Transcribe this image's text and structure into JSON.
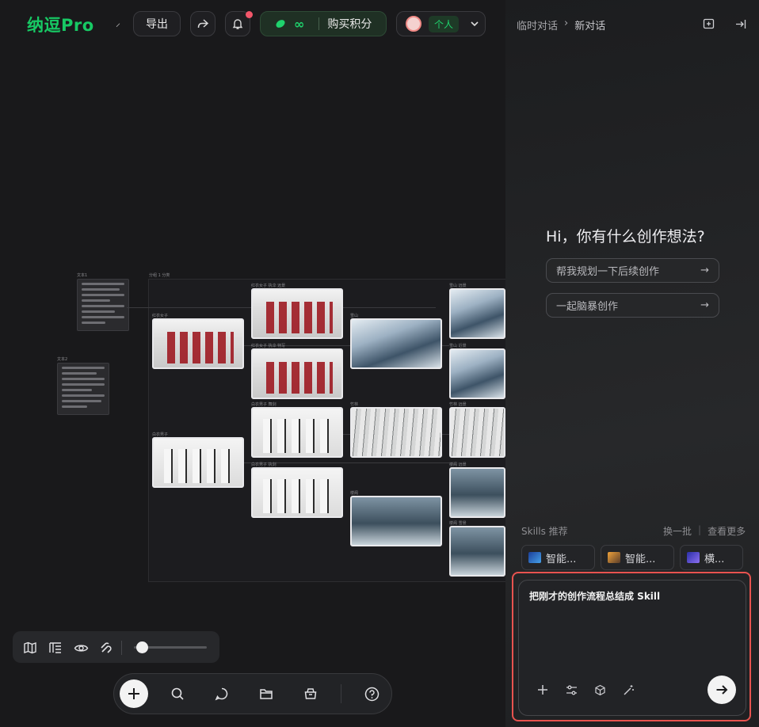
{
  "app": {
    "logo": "纳逗Pro",
    "tick": "⸝"
  },
  "toolbar": {
    "export_label": "导出",
    "credits_symbol": "∞",
    "buy_label": "购买积分",
    "account_tag": "个人"
  },
  "panel": {
    "breadcrumb": [
      "临时对话",
      "新对话"
    ],
    "greeting": "Hi，你有什么创作想法?",
    "suggestions": [
      "帮我规划一下后续创作",
      "一起脑暴创作"
    ],
    "skills_title": "Skills 推荐",
    "skills_refresh": "换一批",
    "skills_more": "查看更多",
    "skills": [
      "智能...",
      "智能...",
      "横..."
    ],
    "prompt_text": "把刚才的创作流程总结成 Skill"
  },
  "canvas": {
    "notes": [
      "文本1",
      "文本2"
    ],
    "board_label": "分组 1 分类",
    "image_labels": [
      "红衣女子",
      "红衣女子 执伞 远景",
      "红衣女子 执伞 特写",
      "雪山",
      "雪山 远景",
      "雪山 近景",
      "白衣男子",
      "白衣男子 舞剑",
      "白衣男子 执剑",
      "竹林",
      "竹林 远景",
      "楼阁",
      "楼阁 远景",
      "楼阁 雪景"
    ]
  },
  "colors": {
    "brand": "#17c964",
    "alert": "#e8534f"
  }
}
